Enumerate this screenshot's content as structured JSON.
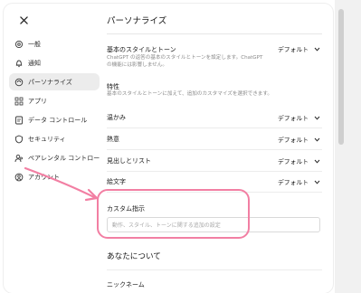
{
  "close_icon": "close-icon",
  "sidebar": {
    "items": [
      {
        "label": "一般",
        "icon": "gear-icon",
        "active": false
      },
      {
        "label": "通知",
        "icon": "bell-icon",
        "active": false
      },
      {
        "label": "パーソナライズ",
        "icon": "personalize-icon",
        "active": true
      },
      {
        "label": "アプリ",
        "icon": "apps-grid-icon",
        "active": false
      },
      {
        "label": "データ コントロール",
        "icon": "data-control-icon",
        "active": false
      },
      {
        "label": "セキュリティ",
        "icon": "shield-icon",
        "active": false
      },
      {
        "label": "ペアレンタル コントロー...",
        "icon": "parental-icon",
        "active": false
      },
      {
        "label": "アカウント",
        "icon": "account-icon",
        "active": false
      }
    ]
  },
  "main": {
    "title": "パーソナライズ",
    "style_section": {
      "label": "基本のスタイルとトーン",
      "description": "ChatGPT の返答の基本のスタイルとトーンを設定します。ChatGPT の機能には影響しません。",
      "value": "デフォルト"
    },
    "characteristics": {
      "label": "特性",
      "description": "基本のスタイルとトーンに加えて、追加のカスタマイズを選択できます。"
    },
    "traits": [
      {
        "label": "温かみ",
        "value": "デフォルト"
      },
      {
        "label": "熱意",
        "value": "デフォルト"
      },
      {
        "label": "見出しとリスト",
        "value": "デフォルト"
      },
      {
        "label": "絵文字",
        "value": "デフォルト"
      }
    ],
    "custom_instructions": {
      "label": "カスタム指示",
      "placeholder": "動作、スタイル、トーンに関する追加の設定"
    },
    "about_you": {
      "title": "あなたについて",
      "nickname_label": "ニックネーム"
    }
  },
  "annotation": {
    "color": "#f27fa3"
  }
}
